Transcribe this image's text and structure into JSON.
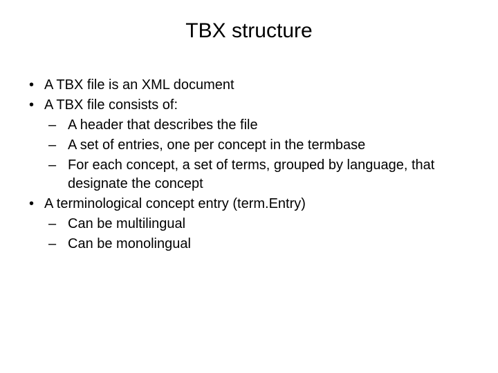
{
  "title": "TBX structure",
  "bullets": {
    "b1": "A TBX file is an XML document",
    "b2": "A TBX file consists of:",
    "b2_1": "A header that describes the file",
    "b2_2": "A set of entries, one per concept in the termbase",
    "b2_3": "For each concept, a set of terms, grouped by language, that designate the concept",
    "b3": "A terminological concept entry (term.Entry)",
    "b3_1": "Can be multilingual",
    "b3_2": "Can be monolingual"
  }
}
